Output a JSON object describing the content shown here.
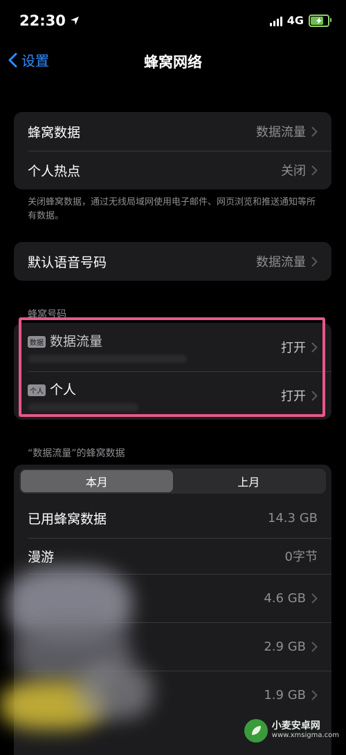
{
  "status_bar": {
    "time": "22:30",
    "network": "4G"
  },
  "nav": {
    "back_label": "设置",
    "title": "蜂窝网络"
  },
  "group1": {
    "rows": [
      {
        "label": "蜂窝数据",
        "value": "数据流量"
      },
      {
        "label": "个人热点",
        "value": "关闭"
      }
    ],
    "footnote": "关闭蜂窝数据，通过无线局域网使用电子邮件、网页浏览和推送通知等所有数据。"
  },
  "group2": {
    "label": "默认语音号码",
    "value": "数据流量"
  },
  "sim_section": {
    "header": "蜂窝号码",
    "sims": [
      {
        "badge": "数据",
        "name": "数据流量",
        "status": "打开"
      },
      {
        "badge": "个人",
        "name": "个人",
        "status": "打开"
      }
    ]
  },
  "usage_section": {
    "header": "“数据流量”的蜂窝数据",
    "tabs": [
      "本月",
      "上月"
    ],
    "active_tab": 0,
    "rows": [
      {
        "label": "已用蜂窝数据",
        "value": "14.3 GB"
      },
      {
        "label": "漫游",
        "value": "0字节"
      }
    ],
    "app_rows": [
      {
        "value": "4.6 GB"
      },
      {
        "value": "2.9 GB"
      },
      {
        "value": "1.9 GB"
      }
    ]
  },
  "watermark": {
    "title": "小麦安卓网",
    "url": "www.xmsigma.com"
  },
  "colors": {
    "accent": "#2f8cff",
    "highlight": "#e8578a",
    "battery": "#6cc04a"
  }
}
